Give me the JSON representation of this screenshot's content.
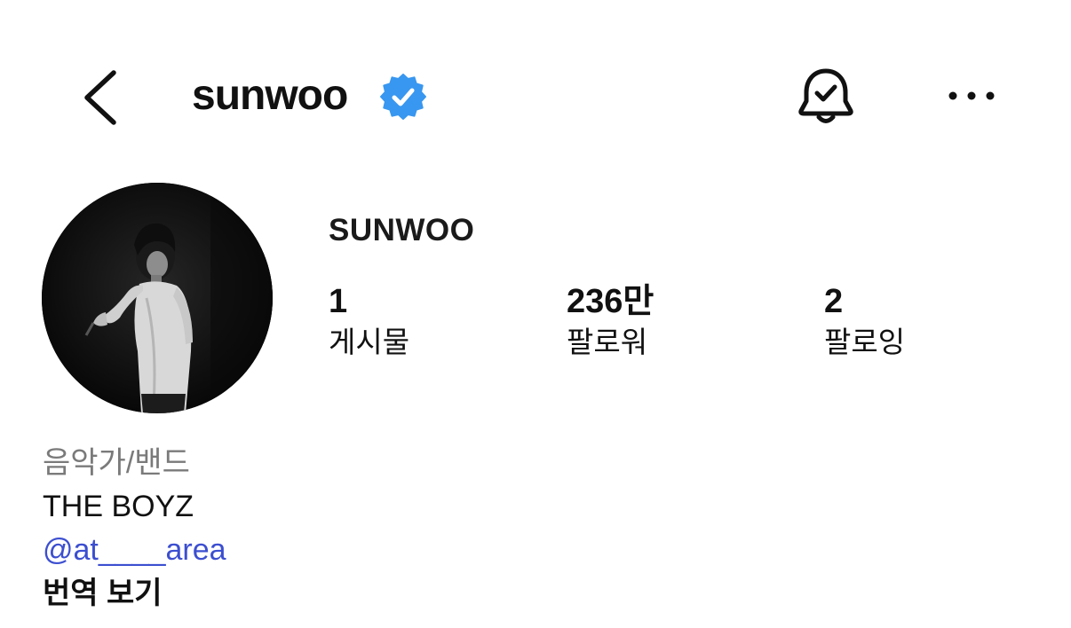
{
  "header": {
    "username": "sunwoo",
    "back_icon": "chevron-left-icon",
    "verified_icon": "verified-badge-icon",
    "verified_color": "#3897f0",
    "bell_icon": "bell-check-icon",
    "more_icon": "more-horizontal-icon"
  },
  "profile": {
    "display_name": "SUNWOO",
    "avatar": "profile-photo",
    "stats": [
      {
        "value": "1",
        "label": "게시물"
      },
      {
        "value": "236만",
        "label": "팔로워"
      },
      {
        "value": "2",
        "label": "팔로잉"
      }
    ]
  },
  "bio": {
    "category": "음악가/밴드",
    "text": "THE BOYZ",
    "mention": "@at____area",
    "mention_color": "#3c4fd0",
    "translate_label": "번역 보기"
  }
}
